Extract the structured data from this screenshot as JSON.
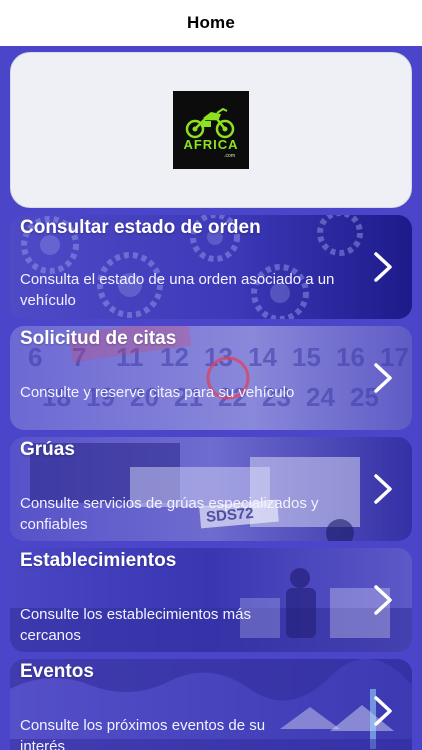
{
  "nav": {
    "title": "Home"
  },
  "logo": {
    "brand": "AFRICA",
    "sub": ".com"
  },
  "menu": [
    {
      "title": "Consultar estado de orden",
      "desc": "Consulta el estado de una orden asociado a un vehículo"
    },
    {
      "title": "Solicitud de citas",
      "desc": "Consulte y reserve citas para su vehículo"
    },
    {
      "title": "Grúas",
      "desc": "Consulte servicios de grúas especializados y confiables"
    },
    {
      "title": "Establecimientos",
      "desc": "Consulte los establecimientos más cercanos"
    },
    {
      "title": "Eventos",
      "desc": "Consulte los próximos eventos de su interés"
    }
  ],
  "calendar_numbers": [
    "6",
    "7",
    "11",
    "12",
    "13",
    "14",
    "15",
    "16",
    "17",
    "18",
    "19",
    "20",
    "21",
    "22",
    "23",
    "24",
    "25"
  ],
  "plate_text": "SDS72",
  "icons": {
    "chevron": "chevron-right-icon",
    "logo_image": "motorcycle-icon"
  },
  "colors": {
    "primary": "#4b45c9",
    "logo_green": "#8ce21f",
    "card_bg": "#eef0f6"
  }
}
